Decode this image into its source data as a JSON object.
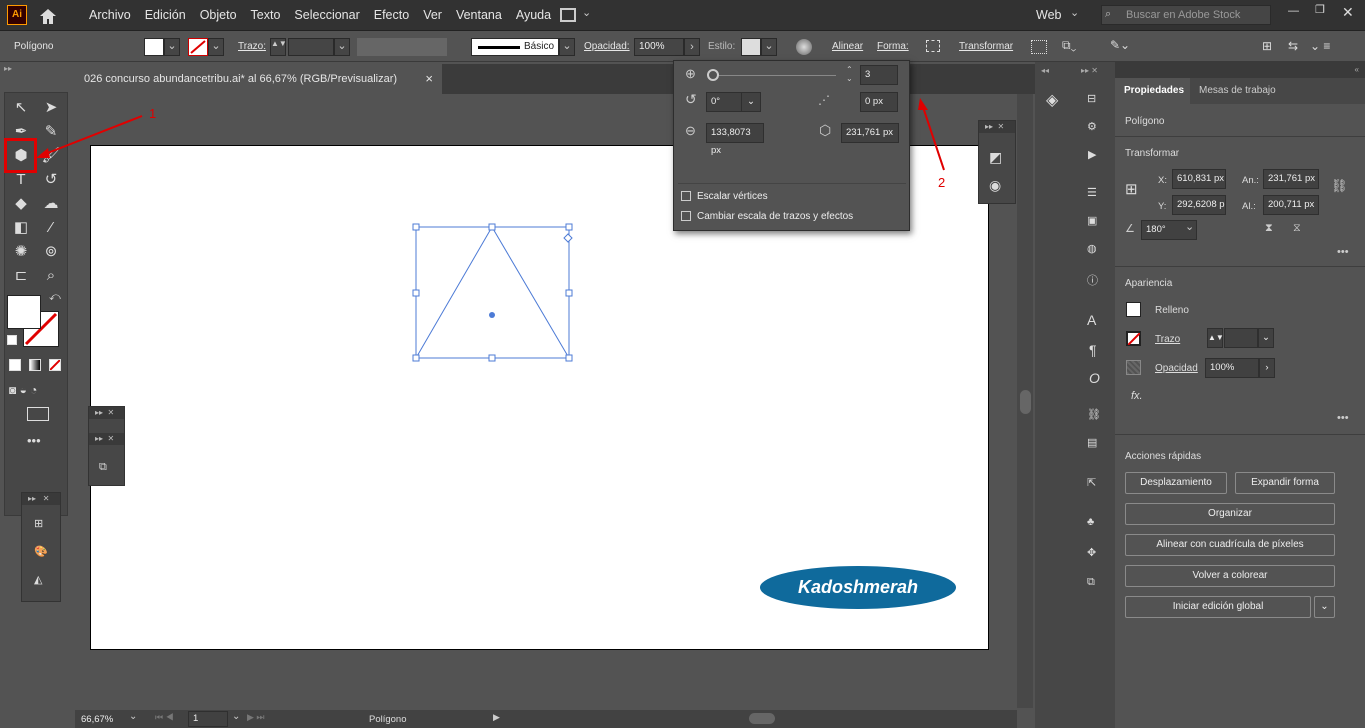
{
  "app": {
    "logo": "Ai"
  },
  "menu": {
    "items": [
      "Archivo",
      "Edición",
      "Objeto",
      "Texto",
      "Seleccionar",
      "Efecto",
      "Ver",
      "Ventana",
      "Ayuda"
    ]
  },
  "workspace": {
    "label": "Web",
    "search_placeholder": "Buscar en Adobe Stock"
  },
  "control": {
    "object_type": "Polígono",
    "stroke_label": "Trazo:",
    "brush_label": "Básico",
    "opacity_label": "Opacidad:",
    "opacity_value": "100%",
    "style_label": "Estilo:",
    "align_label": "Alinear",
    "shape_label": "Forma:",
    "transform_label": "Transformar"
  },
  "document": {
    "tab_title": "026 concurso abundancetribu.ai* al 66,67% (RGB/Previsualizar)",
    "close": "×"
  },
  "polygon_popup": {
    "sides": "3",
    "rotation": "0°",
    "corner": "0 px",
    "radius": "133,8073 px",
    "side_length": "231,761 px",
    "scale_vertices": "Escalar vértices",
    "scale_strokes": "Cambiar escala de trazos y efectos"
  },
  "annotations": {
    "one": "1",
    "two": "2"
  },
  "watermark": "Kadoshmerah",
  "status": {
    "zoom": "66,67%",
    "artboard": "1",
    "tool": "Polígono"
  },
  "properties": {
    "tabs": [
      "Propiedades",
      "Mesas de trabajo"
    ],
    "object_type": "Polígono",
    "transform_title": "Transformar",
    "x_label": "X:",
    "x_value": "610,831 px",
    "y_label": "Y:",
    "y_value": "292,6208 p",
    "w_label": "An.:",
    "w_value": "231,761 px",
    "h_label": "Al.:",
    "h_value": "200,711 px",
    "angle_value": "180°",
    "appearance_title": "Apariencia",
    "fill_label": "Relleno",
    "stroke_label": "Trazo",
    "opacity_label": "Opacidad",
    "opacity_value": "100%",
    "fx_label": "fx.",
    "more": "•••",
    "quick_title": "Acciones rápidas",
    "quick_actions": {
      "offset": "Desplazamiento",
      "expand": "Expandir forma",
      "arrange": "Organizar",
      "pixel_grid": "Alinear con cuadrícula de píxeles",
      "recolor": "Volver a colorear",
      "global_edit": "Iniciar edición global"
    }
  },
  "colors": {
    "accent_red": "#e00000",
    "selection_blue": "#4d7bd6",
    "watermark_blue": "#0f6a9c"
  }
}
